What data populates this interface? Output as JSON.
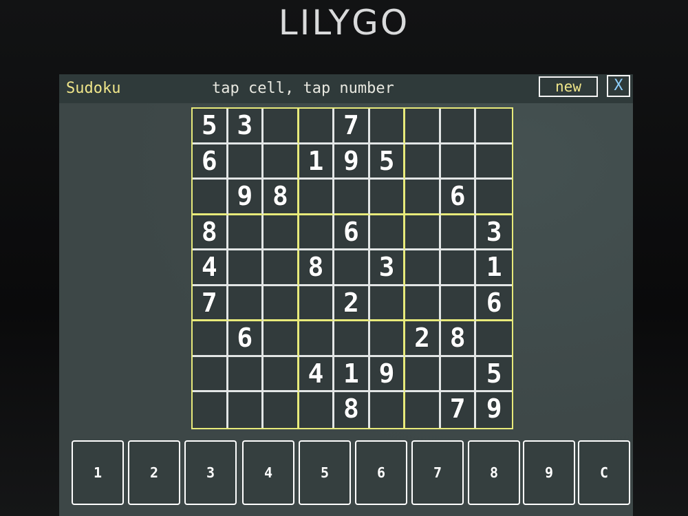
{
  "device": {
    "brand": "LILYGO"
  },
  "header": {
    "app_title": "Sudoku",
    "hint": "tap cell, tap number",
    "new_label": "new",
    "close_label": "X"
  },
  "sudoku": {
    "rows": [
      [
        "5",
        "3",
        "",
        "",
        "7",
        "",
        "",
        "",
        ""
      ],
      [
        "6",
        "",
        "",
        "1",
        "9",
        "5",
        "",
        "",
        ""
      ],
      [
        "",
        "9",
        "8",
        "",
        "",
        "",
        "",
        "6",
        ""
      ],
      [
        "8",
        "",
        "",
        "",
        "6",
        "",
        "",
        "",
        "3"
      ],
      [
        "4",
        "",
        "",
        "8",
        "",
        "3",
        "",
        "",
        "1"
      ],
      [
        "7",
        "",
        "",
        "",
        "2",
        "",
        "",
        "",
        "6"
      ],
      [
        "",
        "6",
        "",
        "",
        "",
        "",
        "2",
        "8",
        ""
      ],
      [
        "",
        "",
        "",
        "4",
        "1",
        "9",
        "",
        "",
        "5"
      ],
      [
        "",
        "",
        "",
        "",
        "8",
        "",
        "",
        "7",
        "9"
      ]
    ]
  },
  "keypad": {
    "keys": [
      "1",
      "2",
      "3",
      "4",
      "5",
      "6",
      "7",
      "8",
      "9",
      "C"
    ]
  },
  "colors": {
    "screen_bg": "#3d4747",
    "accent_yellow": "#f0e68a",
    "grid_box_border": "#e8ea7a",
    "close_blue": "#8fd0ff"
  }
}
